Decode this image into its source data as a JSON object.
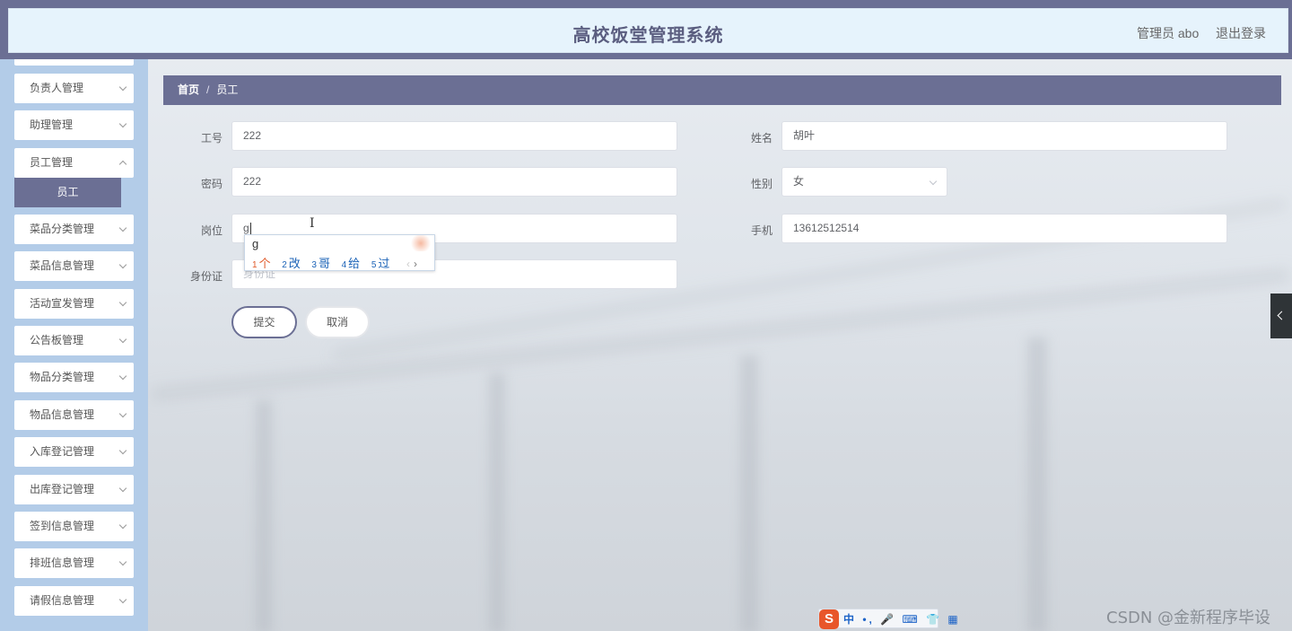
{
  "header": {
    "title": "高校饭堂管理系统",
    "user": "管理员 abo",
    "logout": "退出登录"
  },
  "sidebar": {
    "items": [
      {
        "label": "负责人管理"
      },
      {
        "label": "助理管理"
      },
      {
        "label": "员工管理"
      },
      {
        "label": "菜品分类管理"
      },
      {
        "label": "菜品信息管理"
      },
      {
        "label": "活动宣发管理"
      },
      {
        "label": "公告板管理"
      },
      {
        "label": "物品分类管理"
      },
      {
        "label": "物品信息管理"
      },
      {
        "label": "入库登记管理"
      },
      {
        "label": "出库登记管理"
      },
      {
        "label": "签到信息管理"
      },
      {
        "label": "排班信息管理"
      },
      {
        "label": "请假信息管理"
      }
    ],
    "active_sub": "员工"
  },
  "breadcrumb": {
    "home": "首页",
    "separator": "/",
    "current": "员工"
  },
  "form": {
    "gonghao": {
      "label": "工号",
      "value": "222"
    },
    "xingming": {
      "label": "姓名",
      "value": "胡叶"
    },
    "mima": {
      "label": "密码",
      "value": "222"
    },
    "xingbie": {
      "label": "性别",
      "value": "女"
    },
    "gangwei": {
      "label": "岗位",
      "value": "g"
    },
    "shouji": {
      "label": "手机",
      "value": "13612512514"
    },
    "shenfenzheng": {
      "label": "身份证",
      "placeholder": "身份证"
    },
    "submit": "提交",
    "cancel": "取消"
  },
  "ime": {
    "composition": "g",
    "candidates": [
      {
        "num": "1",
        "text": "个"
      },
      {
        "num": "2",
        "text": "改"
      },
      {
        "num": "3",
        "text": "哥"
      },
      {
        "num": "4",
        "text": "给"
      },
      {
        "num": "5",
        "text": "过"
      }
    ],
    "prev": "‹",
    "next": "›"
  },
  "ime_toolbar": {
    "logo": "S",
    "items": "中 •, 🎤 ⌨ 👕 ▦"
  },
  "watermark": "CSDN @金新程序毕设",
  "colors": {
    "header_frame": "#6b6f94",
    "header_bg": "#e6f3fc",
    "sidebar_bg": "#b3cce8",
    "accent": "#6b6f94"
  }
}
